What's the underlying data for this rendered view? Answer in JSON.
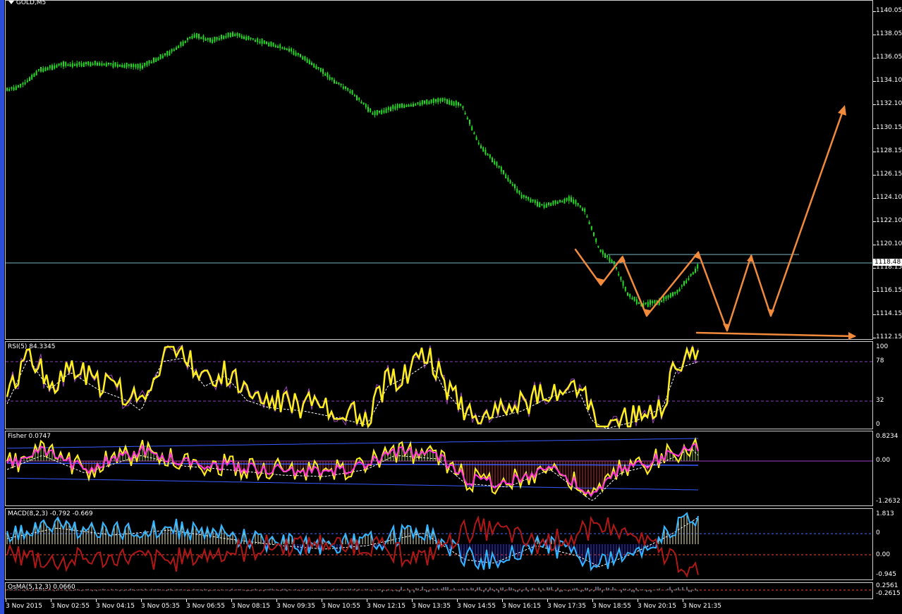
{
  "symbol": {
    "label": "GOLD,M5",
    "menu_icon": "triangle-down-icon"
  },
  "colors": {
    "background": "#000000",
    "bull_candle": "#22dd22",
    "drawing": "#f28a3c",
    "level_line": "#7ab8c2"
  },
  "price_axis": {
    "labels": [
      "1140.05",
      "1138.05",
      "1136.05",
      "1134.10",
      "1132.10",
      "1130.15",
      "1128.15",
      "1126.15",
      "1124.10",
      "1122.10",
      "1120.10",
      "1118.15",
      "1116.15",
      "1114.15",
      "1112.15"
    ],
    "current": "1118.48"
  },
  "panes": {
    "rsi": {
      "label": "RSI(5) 84.3345",
      "axis": [
        "100",
        "78",
        "32",
        "0"
      ]
    },
    "fisher": {
      "label": "Fisher 0.0747",
      "axis": [
        "0.8234",
        "0.00",
        "-1.2632"
      ]
    },
    "macd": {
      "label": "MACD(8,2,3) -0.792 -0.669",
      "axis": [
        "1.813",
        "0",
        "0.00",
        "-0.945"
      ]
    },
    "osma": {
      "label": "OsMA(5,12,3) 0.0660",
      "axis": [
        "0.2561",
        "-0.2615"
      ]
    }
  },
  "time_axis": [
    "3 Nov 2015",
    "3 Nov 02:55",
    "3 Nov 04:15",
    "3 Nov 05:35",
    "3 Nov 06:55",
    "3 Nov 08:15",
    "3 Nov 09:35",
    "3 Nov 10:55",
    "3 Nov 12:15",
    "3 Nov 13:35",
    "3 Nov 14:55",
    "3 Nov 16:15",
    "3 Nov 17:35",
    "3 Nov 18:55",
    "3 Nov 20:15",
    "3 Nov 21:35"
  ]
}
